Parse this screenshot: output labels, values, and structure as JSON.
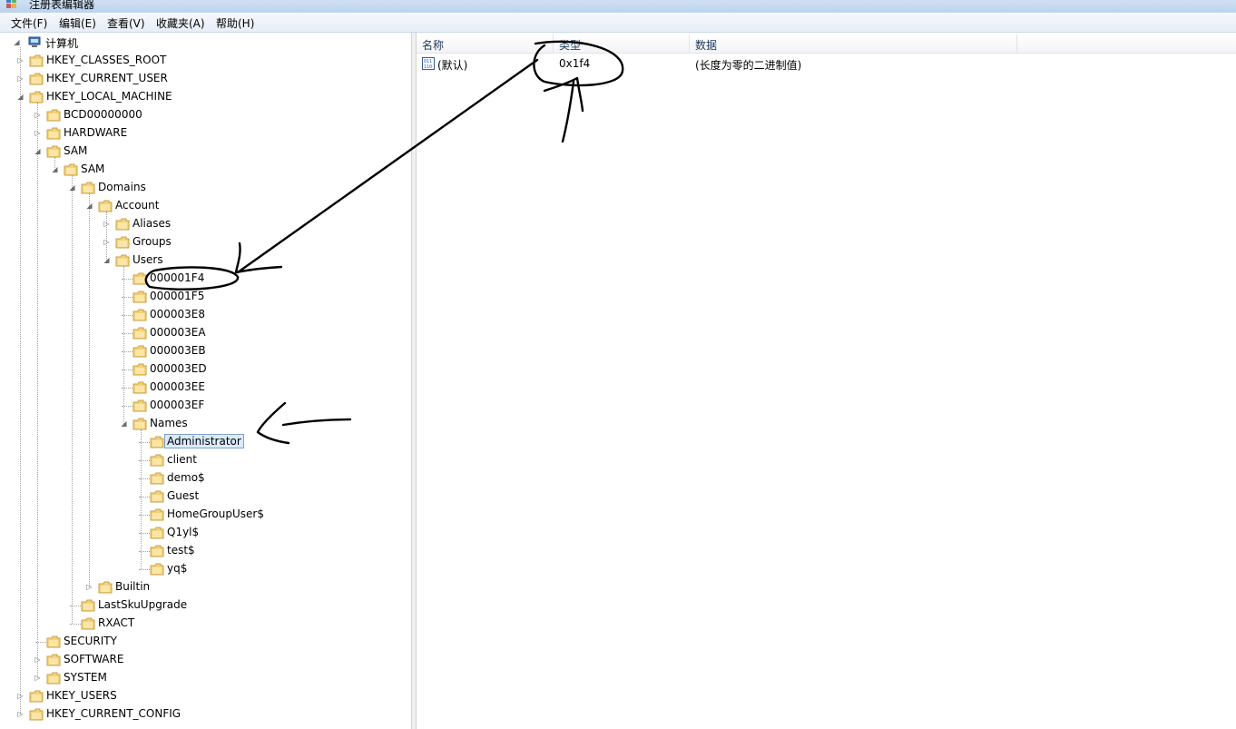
{
  "window": {
    "title": "注册表编辑器",
    "menu": [
      "文件(F)",
      "编辑(E)",
      "查看(V)",
      "收藏夹(A)",
      "帮助(H)"
    ]
  },
  "tree": {
    "root": "计算机",
    "items": [
      "HKEY_CLASSES_ROOT",
      "HKEY_CURRENT_USER",
      "HKEY_LOCAL_MACHINE",
      "BCD00000000",
      "HARDWARE",
      "SAM",
      "SAM",
      "Domains",
      "Account",
      "Aliases",
      "Groups",
      "Users",
      "000001F4",
      "000001F5",
      "000003E8",
      "000003EA",
      "000003EB",
      "000003ED",
      "000003EE",
      "000003EF",
      "Names",
      "Administrator",
      "client",
      "demo$",
      "Guest",
      "HomeGroupUser$",
      "Q1yl$",
      "test$",
      "yq$",
      "Builtin",
      "LastSkuUpgrade",
      "RXACT",
      "SECURITY",
      "SOFTWARE",
      "SYSTEM",
      "HKEY_USERS",
      "HKEY_CURRENT_CONFIG"
    ],
    "selected": "Administrator"
  },
  "list": {
    "columns": [
      "名称",
      "类型",
      "数据"
    ],
    "rows": [
      {
        "name": "(默认)",
        "type": "0x1f4",
        "data": "(长度为零的二进制值)"
      }
    ]
  },
  "colors": {
    "title_bar": "#bcd3ee",
    "selection_bg": "#dcebfc",
    "selection_border": "#7da2ce",
    "folder_fill": "#f4d27a",
    "annotation_ink": "#000000"
  }
}
